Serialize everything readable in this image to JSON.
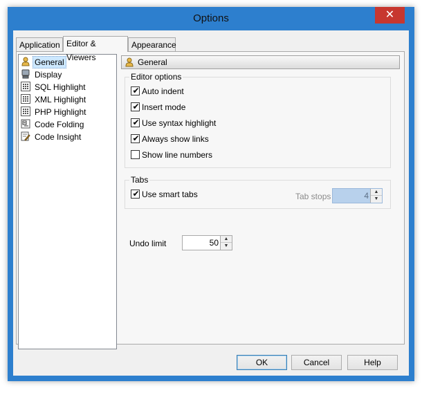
{
  "window": {
    "title": "Options",
    "close_glyph": "✕"
  },
  "tabs": [
    {
      "label": "Application",
      "active": false
    },
    {
      "label": "Editor & Viewers",
      "active": true
    },
    {
      "label": "Appearance",
      "active": false
    }
  ],
  "tree": {
    "items": [
      {
        "label": "General",
        "icon": "general-icon",
        "selected": true
      },
      {
        "label": "Display",
        "icon": "display-icon",
        "selected": false
      },
      {
        "label": "SQL Highlight",
        "icon": "grid-icon",
        "selected": false
      },
      {
        "label": "XML Highlight",
        "icon": "grid-icon",
        "selected": false
      },
      {
        "label": "PHP Highlight",
        "icon": "grid-icon",
        "selected": false
      },
      {
        "label": "Code Folding",
        "icon": "code-folding-icon",
        "selected": false
      },
      {
        "label": "Code Insight",
        "icon": "code-insight-icon",
        "selected": false
      }
    ]
  },
  "header": {
    "title": "General",
    "icon": "general-icon"
  },
  "editor_options": {
    "title": "Editor options",
    "checks": [
      {
        "label": "Auto indent",
        "checked": true
      },
      {
        "label": "Insert mode",
        "checked": true
      },
      {
        "label": "Use syntax highlight",
        "checked": true
      },
      {
        "label": "Always show links",
        "checked": true
      },
      {
        "label": "Show line numbers",
        "checked": false
      }
    ]
  },
  "tabs_group": {
    "title": "Tabs",
    "use_smart_tabs": {
      "label": "Use smart tabs",
      "checked": true
    },
    "tab_stops": {
      "label": "Tab stops",
      "value": "4",
      "enabled": false
    }
  },
  "undo_limit": {
    "label": "Undo limit",
    "value": "50"
  },
  "buttons": {
    "ok": "OK",
    "cancel": "Cancel",
    "help": "Help"
  },
  "colors": {
    "window_frame": "#2d7fce",
    "close_button": "#c7372f",
    "selection": "#cde8ff"
  }
}
